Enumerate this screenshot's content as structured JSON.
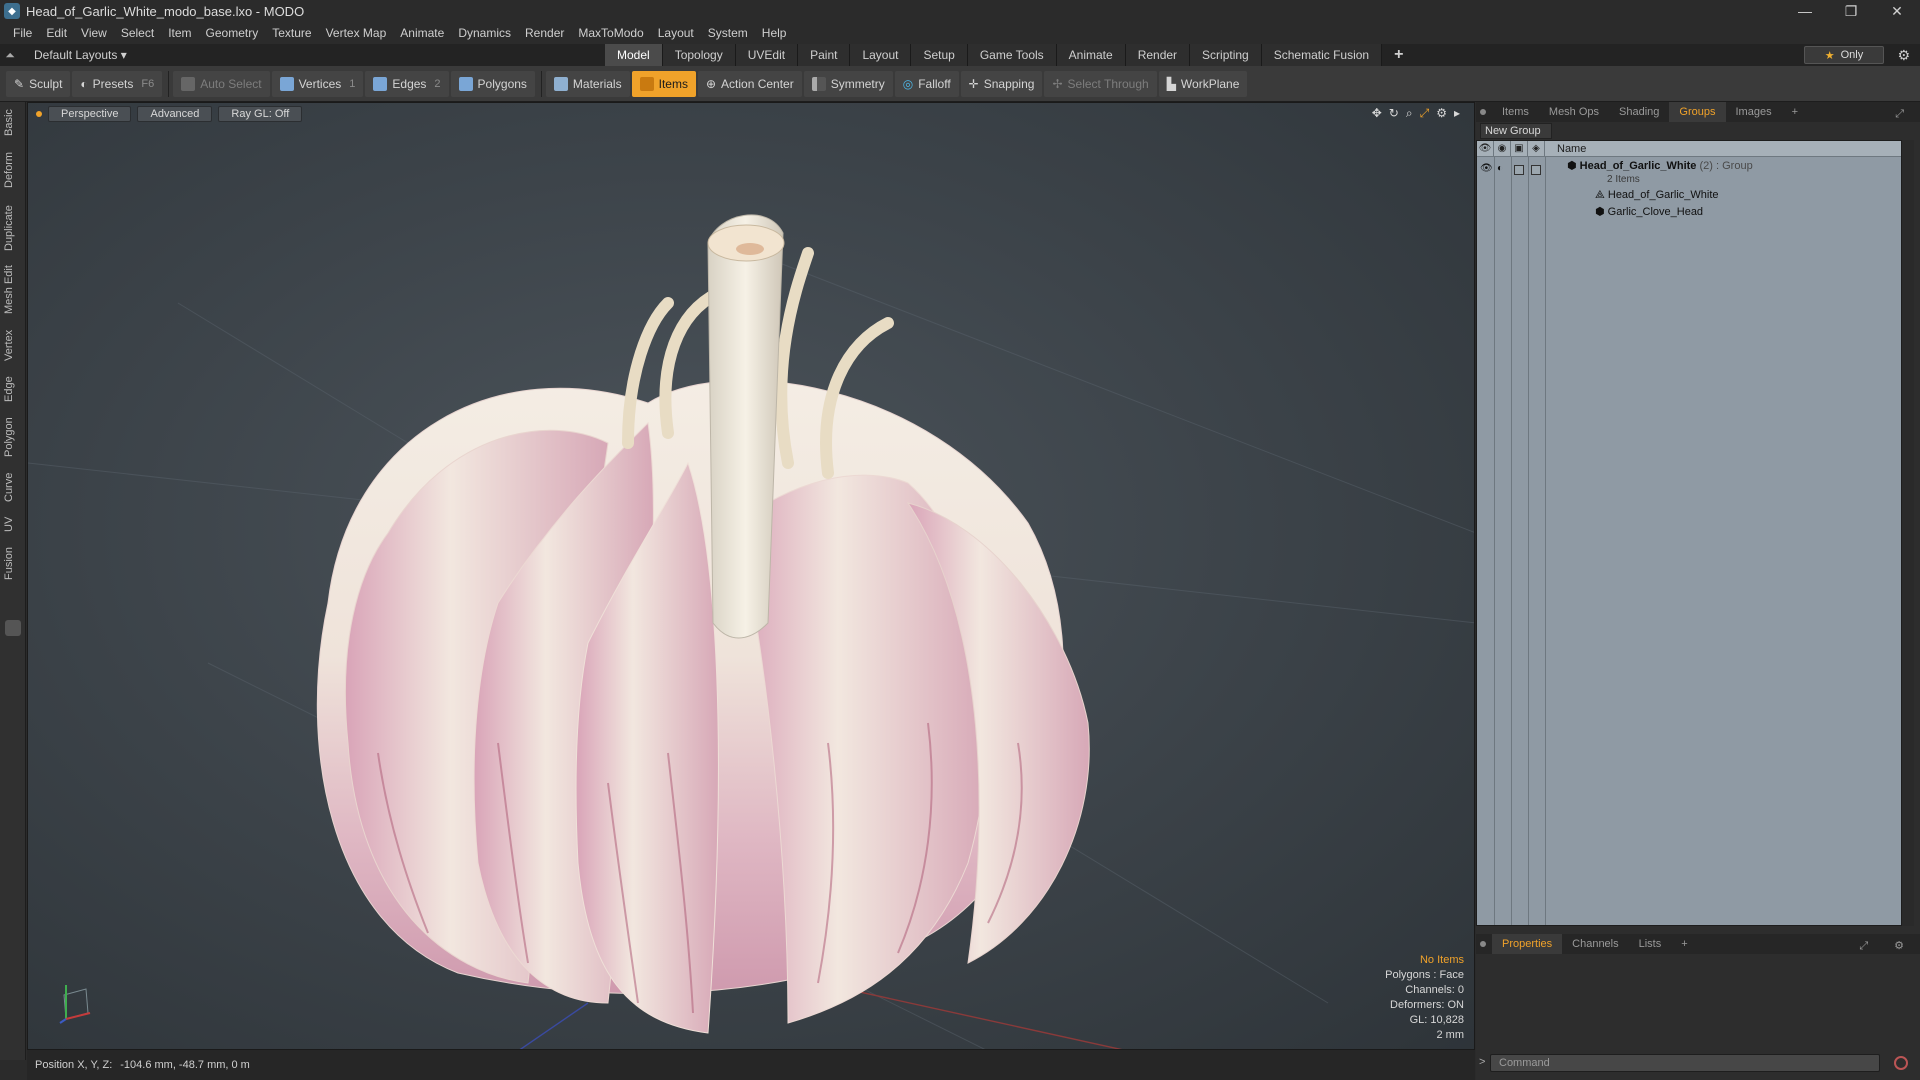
{
  "window": {
    "title": "Head_of_Garlic_White_modo_base.lxo - MODO",
    "minimize": "—",
    "restore": "❐",
    "close": "✕"
  },
  "menu": [
    "File",
    "Edit",
    "View",
    "Select",
    "Item",
    "Geometry",
    "Texture",
    "Vertex Map",
    "Animate",
    "Dynamics",
    "Render",
    "MaxToModo",
    "Layout",
    "System",
    "Help"
  ],
  "layoutbar": {
    "layout_select": "Default Layouts ▾",
    "tabs": [
      "Model",
      "Topology",
      "UVEdit",
      "Paint",
      "Layout",
      "Setup",
      "Game Tools",
      "Animate",
      "Render",
      "Scripting",
      "Schematic Fusion"
    ],
    "active_tab": "Model",
    "add_tab": "+",
    "only_label": "Only"
  },
  "toolbar": {
    "sculpt": "Sculpt",
    "presets": "Presets",
    "presets_key": "F6",
    "auto_select": "Auto Select",
    "vertices": "Vertices",
    "vertices_key": "1",
    "edges": "Edges",
    "edges_key": "2",
    "polygons": "Polygons",
    "materials": "Materials",
    "items": "Items",
    "action_center": "Action Center",
    "symmetry": "Symmetry",
    "falloff": "Falloff",
    "snapping": "Snapping",
    "select_through": "Select Through",
    "workplane": "WorkPlane"
  },
  "sidebar": [
    "Basic",
    "Deform",
    "Duplicate",
    "Mesh Edit",
    "Vertex",
    "Edge",
    "Polygon",
    "Curve",
    "UV",
    "Fusion"
  ],
  "viewport": {
    "view": "Perspective",
    "shading": "Advanced",
    "raygl": "Ray GL: Off",
    "info": {
      "no_items": "No Items",
      "polygons": "Polygons : Face",
      "channels": "Channels: 0",
      "deformers": "Deformers: ON",
      "gl": "GL: 10,828",
      "scale": "2 mm"
    }
  },
  "status": {
    "position_label": "Position X, Y, Z:",
    "position_value": "-104.6 mm, -48.7 mm, 0 m"
  },
  "right_panel": {
    "tabs": [
      "Items",
      "Mesh Ops",
      "Shading",
      "Groups",
      "Images"
    ],
    "active_tab": "Groups",
    "add": "+",
    "new_group": "New Group",
    "column_name": "Name",
    "group": {
      "name": "Head_of_Garlic_White",
      "count": "(2)",
      "type": ": Group",
      "items_label": "2 Items"
    },
    "children": [
      "Head_of_Garlic_White",
      "Garlic_Clove_Head"
    ]
  },
  "bottom_panel": {
    "tabs": [
      "Properties",
      "Channels",
      "Lists"
    ],
    "active_tab": "Properties",
    "add": "+",
    "command_placeholder": "Command",
    "command_arrow": ">"
  },
  "colors": {
    "accent": "#f0a22a",
    "viewport_bg": "#3b4248",
    "garlic_skin": "#f0e6dc",
    "garlic_blush": "#d8a0b0"
  }
}
